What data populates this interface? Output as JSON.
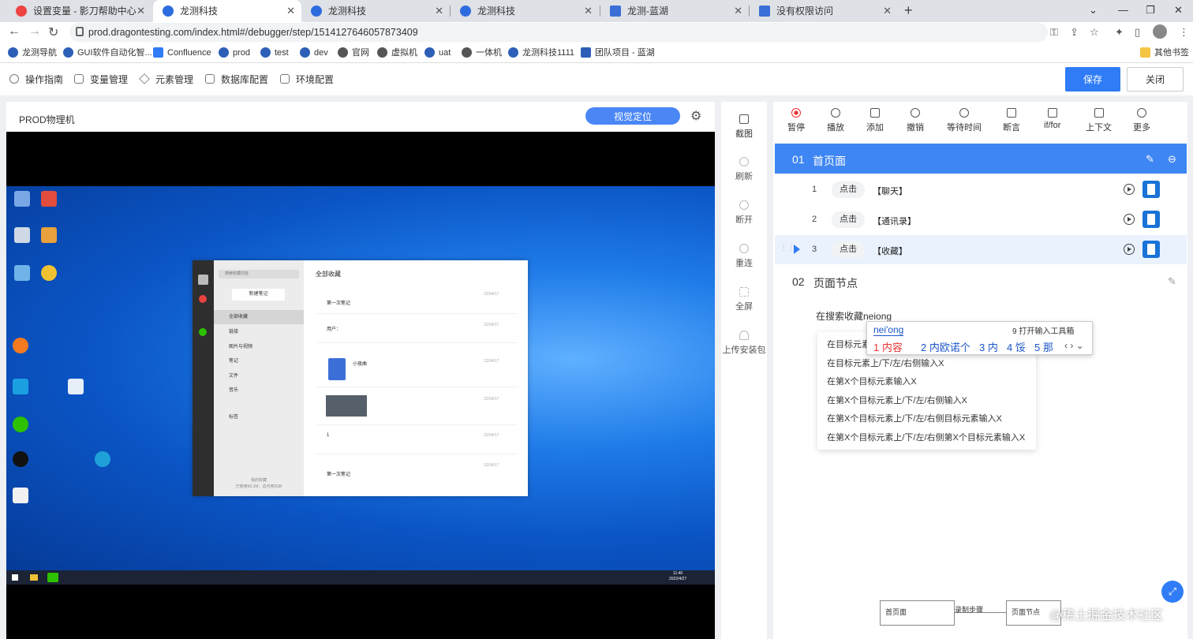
{
  "browser": {
    "tabs": [
      {
        "title": "设置变量 - 影刀帮助中心",
        "active": false
      },
      {
        "title": "龙测科技",
        "active": true
      },
      {
        "title": "龙测科技",
        "active": false
      },
      {
        "title": "龙测科技",
        "active": false
      },
      {
        "title": "龙测-蓝湖",
        "active": false
      },
      {
        "title": "没有权限访问",
        "active": false
      }
    ],
    "url": "prod.dragontesting.com/index.html#/debugger/step/1514127646057873409",
    "bookmarks": [
      "龙测导航",
      "GUI软件自动化智...",
      "Confluence",
      "prod",
      "test",
      "dev",
      "官网",
      "虚拟机",
      "uat",
      "一体机",
      "龙测科技1111",
      "团队项目 - 蓝湖"
    ],
    "other_bookmarks": "其他书签"
  },
  "appbar": {
    "menus": [
      "操作指南",
      "变量管理",
      "元素管理",
      "数据库配置",
      "环境配置"
    ],
    "save": "保存",
    "close": "关闭"
  },
  "device": {
    "name": "PROD物理机",
    "visual_button": "视觉定位",
    "clock_time": "11:40",
    "clock_date": "2022/4/27"
  },
  "wechat": {
    "search": "搜索收藏内容",
    "new_note": "新建笔记",
    "sidebar": [
      "全部收藏",
      "链接",
      "图片与视频",
      "笔记",
      "文件",
      "音乐",
      "标签"
    ],
    "title": "全部收藏",
    "entries": [
      "第一次笔记",
      "用户：",
      "小夜曲",
      "1",
      "第一次笔记"
    ],
    "dates": [
      "22/04/17",
      "22/04/17",
      "22/04/17",
      "22/04/17",
      "22/04/17",
      "22/04/17"
    ],
    "footer_1": "我的收藏",
    "footer_2": "已使用56.1M，总可用2GB"
  },
  "side_tools": [
    "截图",
    "刷新",
    "断开",
    "重连",
    "全屏",
    "上传安装包"
  ],
  "toolbar": [
    "暂停",
    "播放",
    "添加",
    "撤销",
    "等待时间",
    "断言",
    "if/for",
    "上下文",
    "更多"
  ],
  "section1": {
    "num": "01",
    "title": "首页面",
    "steps": [
      {
        "n": "1",
        "action": "点击",
        "target": "【聊天】"
      },
      {
        "n": "2",
        "action": "点击",
        "target": "【通讯录】"
      },
      {
        "n": "3",
        "action": "点击",
        "target": "【收藏】"
      }
    ]
  },
  "section2": {
    "num": "02",
    "title": "页面节点",
    "typing": "在搜索收藏neiong"
  },
  "dropdown": [
    "在目标元素",
    "在目标元素上/下/左/右侧输入X",
    "在第X个目标元素输入X",
    "在第X个目标元素上/下/左/右侧输入X",
    "在第X个目标元素上/下/左/右侧目标元素输入X",
    "在第X个目标元素上/下/左/右侧第X个目标元素输入X"
  ],
  "ime": {
    "pinyin": "nei'ong",
    "tools": "9 打开输入工具箱",
    "candidates": [
      "1 内容",
      "2 内欧诺个",
      "3 内",
      "4 馁",
      "5 那"
    ]
  },
  "minimap": {
    "node1": "首页面",
    "edge": "录制步骤",
    "node2": "页面节点"
  },
  "watermark": "@稀土掘金技术社区"
}
